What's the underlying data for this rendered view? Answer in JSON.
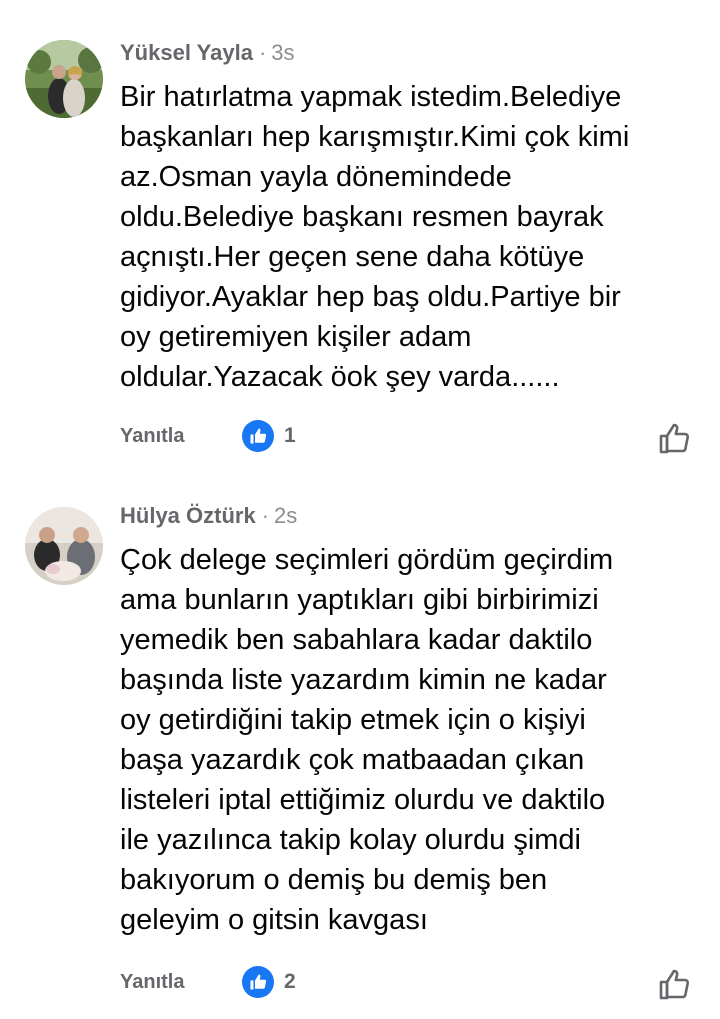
{
  "comments": [
    {
      "author": "Yüksel Yayla",
      "separator": "·",
      "time": "3s",
      "avatar_icon": "profile-photo-avatar",
      "text": "Bir hatırlatma yapmak istedim.Belediye\nbaşkanları hep  karışmıştır.Kimi çok kimi\naz.Osman yayla dönemindede\noldu.Belediye başkanı resmen bayrak\naçnıştı.Her geçen sene daha kötüye\ngidiyor.Ayaklar hep baş oldu.Partiye bir\noy getiremiyen kişiler adam\noldular.Yazacak öok şey varda......",
      "reply_label": "Yanıtla",
      "reaction_icon": "like-icon",
      "reaction_count": "1"
    },
    {
      "author": "Hülya Öztürk",
      "separator": "·",
      "time": "2s",
      "avatar_icon": "profile-photo-avatar",
      "text": "Çok delege seçimleri gördüm geçirdim\nama bunların yaptıkları gibi birbirimizi\nyemedik ben sabahlara kadar daktilo\nbaşında liste yazardım kimin ne kadar\noy getirdiğini takip etmek için o kişiyi\nbaşa yazardık çok matbaadan çıkan\nlisteleri iptal ettiğimiz olurdu ve daktilo\nile yazılınca takip kolay olurdu şimdi\nbakıyorum o demiş bu demiş ben\ngeleyim o gitsin kavgası",
      "reply_label": "Yanıtla",
      "reaction_icon": "like-icon",
      "reaction_count": "2"
    }
  ],
  "colors": {
    "like_blue": "#1877f2",
    "secondary_text": "#65676b",
    "timestamp": "#8a8d91",
    "body_text": "#050505"
  }
}
